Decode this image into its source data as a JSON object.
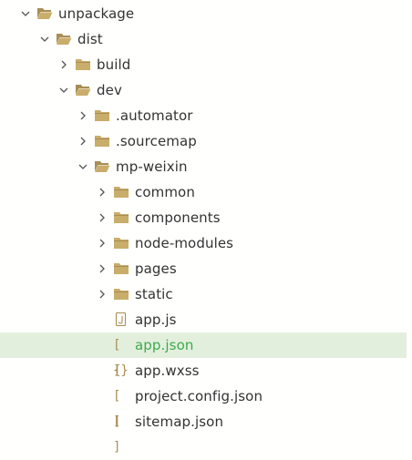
{
  "explorer": {
    "nodes": [
      {
        "label": "unpackage",
        "depth": 0,
        "kind": "folder",
        "expanded": true,
        "icon": "folder-open-icon"
      },
      {
        "label": "dist",
        "depth": 1,
        "kind": "folder",
        "expanded": true,
        "icon": "folder-open-icon"
      },
      {
        "label": "build",
        "depth": 2,
        "kind": "folder",
        "expanded": false,
        "icon": "folder-icon"
      },
      {
        "label": "dev",
        "depth": 2,
        "kind": "folder",
        "expanded": true,
        "icon": "folder-open-icon"
      },
      {
        "label": ".automator",
        "depth": 3,
        "kind": "folder",
        "expanded": false,
        "icon": "folder-icon"
      },
      {
        "label": ".sourcemap",
        "depth": 3,
        "kind": "folder",
        "expanded": false,
        "icon": "folder-icon"
      },
      {
        "label": "mp-weixin",
        "depth": 3,
        "kind": "folder",
        "expanded": true,
        "icon": "folder-open-icon"
      },
      {
        "label": "common",
        "depth": 4,
        "kind": "folder",
        "expanded": false,
        "icon": "folder-icon"
      },
      {
        "label": "components",
        "depth": 4,
        "kind": "folder",
        "expanded": false,
        "icon": "folder-icon"
      },
      {
        "label": "node-modules",
        "depth": 4,
        "kind": "folder",
        "expanded": false,
        "icon": "folder-icon"
      },
      {
        "label": "pages",
        "depth": 4,
        "kind": "folder",
        "expanded": false,
        "icon": "folder-icon"
      },
      {
        "label": "static",
        "depth": 4,
        "kind": "folder",
        "expanded": false,
        "icon": "folder-icon"
      },
      {
        "label": "app.js",
        "depth": 4,
        "kind": "file",
        "icon": "js-file-icon"
      },
      {
        "label": "app.json",
        "depth": 4,
        "kind": "file",
        "icon": "json-file-icon",
        "selected": true
      },
      {
        "label": "app.wxss",
        "depth": 4,
        "kind": "file",
        "icon": "css-file-icon"
      },
      {
        "label": "project.config.json",
        "depth": 4,
        "kind": "file",
        "icon": "json-file-icon"
      },
      {
        "label": "sitemap.json",
        "depth": 4,
        "kind": "file",
        "icon": "json-file-icon"
      }
    ]
  },
  "colors": {
    "folder": "#c9ad6a",
    "folder_dark": "#a88e55",
    "chevron": "#555555",
    "selection_bg": "#e3efdd",
    "selected_text": "#3bab4b",
    "text": "#333333"
  }
}
